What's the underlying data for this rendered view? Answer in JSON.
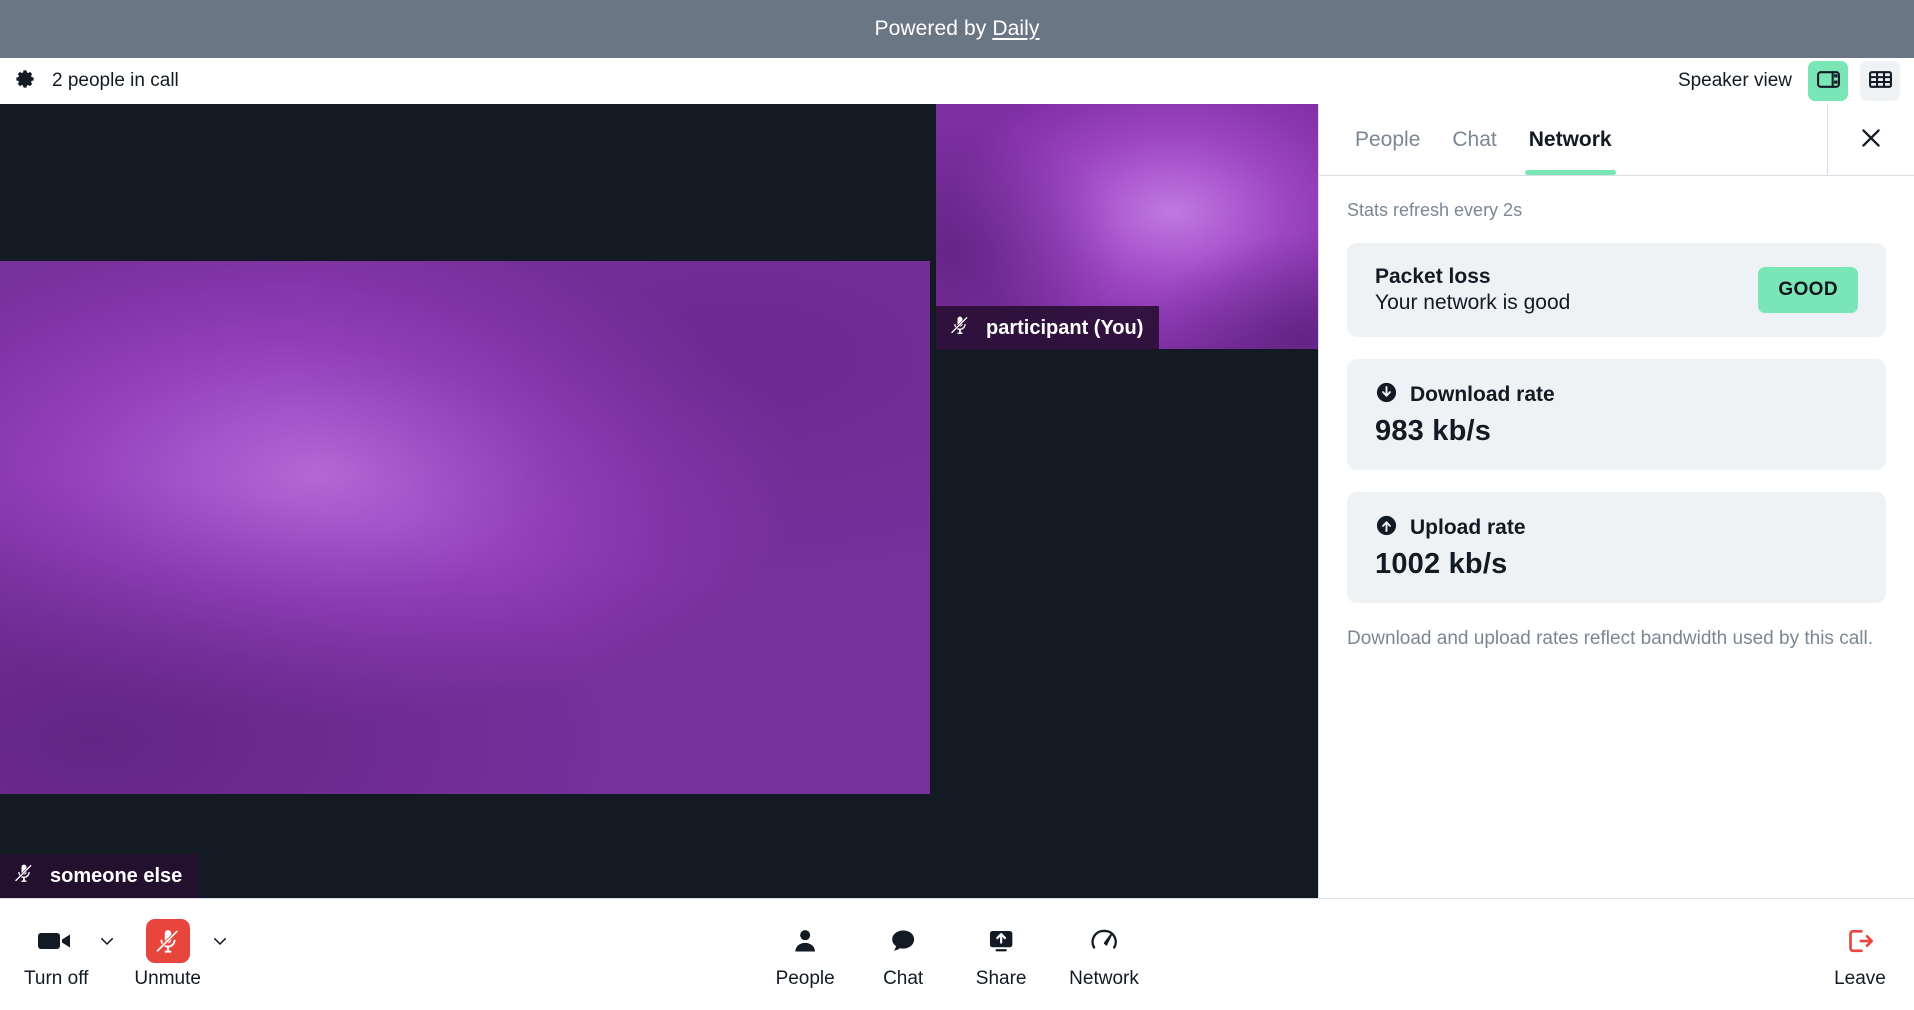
{
  "banner": {
    "prefix": "Powered by ",
    "link_text": "Daily"
  },
  "topbar": {
    "gear_icon": "gear-icon",
    "people_count": "2 people in call",
    "view_label": "Speaker view",
    "speaker_view_icon": "speaker-view-icon",
    "grid_view_icon": "grid-view-icon",
    "active_view": "speaker"
  },
  "stage": {
    "speaker": {
      "name": "someone else",
      "muted": true,
      "mic_icon": "mic-off-icon"
    },
    "self": {
      "name": "participant (You)",
      "muted": true,
      "mic_icon": "mic-off-icon"
    }
  },
  "panel": {
    "tabs": [
      {
        "label": "People",
        "active": false
      },
      {
        "label": "Chat",
        "active": false
      },
      {
        "label": "Network",
        "active": true
      }
    ],
    "close_icon": "close-icon",
    "refresh_note": "Stats refresh every 2s",
    "packet_loss": {
      "title": "Packet loss",
      "subtitle": "Your network is good",
      "badge": "GOOD",
      "badge_color": "#7ae6b6"
    },
    "download": {
      "icon": "download-circle-icon",
      "label": "Download rate",
      "value": "983 kb/s"
    },
    "upload": {
      "icon": "upload-circle-icon",
      "label": "Upload rate",
      "value": "1002 kb/s"
    },
    "note": "Download and upload rates reflect bandwidth used by this call."
  },
  "toolbar": {
    "camera": {
      "label": "Turn off",
      "icon": "camera-icon",
      "caret_icon": "chevron-down-icon",
      "state": "on"
    },
    "mic": {
      "label": "Unmute",
      "icon": "mic-off-icon",
      "caret_icon": "chevron-down-icon",
      "state": "muted",
      "color": "#e8453c"
    },
    "center": [
      {
        "label": "People",
        "icon": "person-icon"
      },
      {
        "label": "Chat",
        "icon": "chat-bubble-icon"
      },
      {
        "label": "Share",
        "icon": "screen-share-icon"
      },
      {
        "label": "Network",
        "icon": "speedometer-icon"
      }
    ],
    "leave": {
      "label": "Leave",
      "icon": "leave-icon",
      "color": "#e8453c"
    }
  },
  "colors": {
    "accent_mint": "#7ae6b6",
    "danger_red": "#e8453c",
    "banner_gray": "#6b7684",
    "stage_dark": "#141a23",
    "card_bg": "#eef2f5",
    "muted_text": "#7b8794"
  }
}
